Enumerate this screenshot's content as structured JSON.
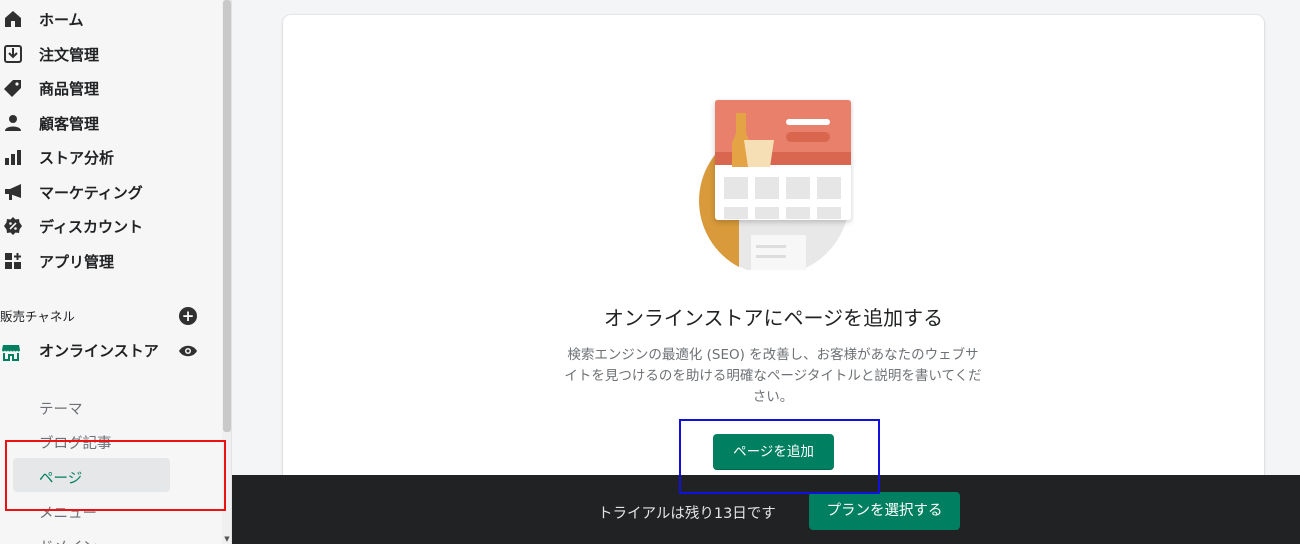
{
  "sidebar": {
    "nav_items": [
      {
        "label": "ホーム",
        "icon": "home-icon"
      },
      {
        "label": "注文管理",
        "icon": "orders-icon"
      },
      {
        "label": "商品管理",
        "icon": "tag-icon"
      },
      {
        "label": "顧客管理",
        "icon": "customer-icon"
      },
      {
        "label": "ストア分析",
        "icon": "analytics-icon"
      },
      {
        "label": "マーケティング",
        "icon": "megaphone-icon"
      },
      {
        "label": "ディスカウント",
        "icon": "discount-icon"
      },
      {
        "label": "アプリ管理",
        "icon": "apps-icon"
      }
    ],
    "sales_channels_title": "販売チャネル",
    "online_store_label": "オンラインストア",
    "sub_items": [
      "テーマ",
      "ブログ記事",
      "ページ",
      "メニュー",
      "ドメイン"
    ],
    "active_sub_item": "ページ"
  },
  "main": {
    "title": "オンラインストアにページを追加する",
    "description": "検索エンジンの最適化 (SEO) を改善し、お客様があなたのウェブサイトを見つけるのを助ける明確なページタイトルと説明を書いてください。",
    "add_page_button": "ページを追加"
  },
  "trial_bar": {
    "text": "トライアルは残り13日です",
    "select_plan_button": "プランを選択する"
  },
  "colors": {
    "primary_green": "#008060",
    "dark_bar": "#202223",
    "annotation_red": "#ee1111",
    "annotation_blue": "#1111dd"
  }
}
